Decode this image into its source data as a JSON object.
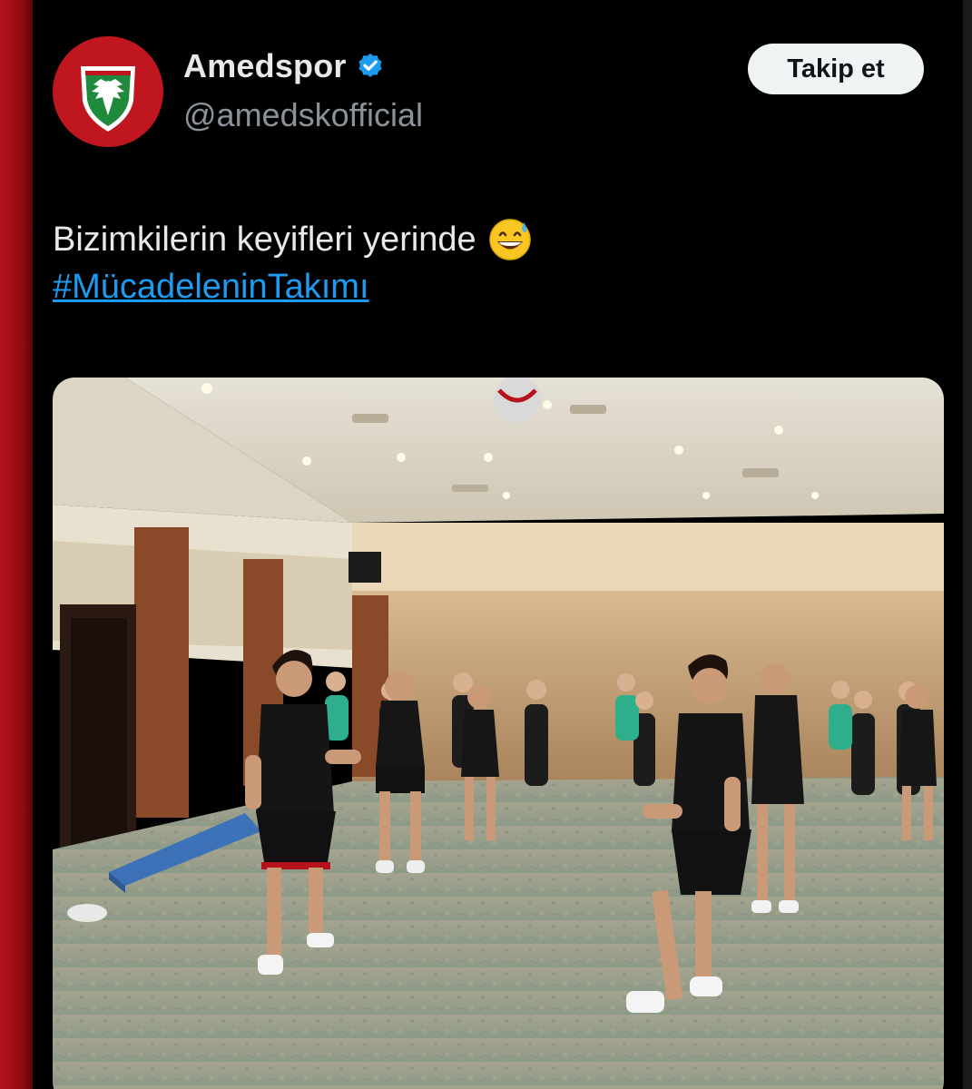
{
  "account": {
    "display_name": "Amedspor",
    "handle": "@amedskofficial",
    "verified": true,
    "avatar_icon": "amedspor-crest-icon"
  },
  "actions": {
    "follow_label": "Takip et"
  },
  "tweet": {
    "text": "Bizimkilerin keyifleri yerinde",
    "emoji": "grinning-face-with-sweat-icon",
    "hashtag": "#MücadeleninTakımı"
  },
  "media": {
    "type": "video",
    "content": "players-training-in-hotel-ballroom"
  },
  "colors": {
    "background": "#000000",
    "link": "#1d9bf0",
    "verified_badge": "#1d9bf0",
    "crest_red": "#c0161f",
    "crest_green": "#1f8a3c",
    "side_strip": "#b5121b"
  }
}
